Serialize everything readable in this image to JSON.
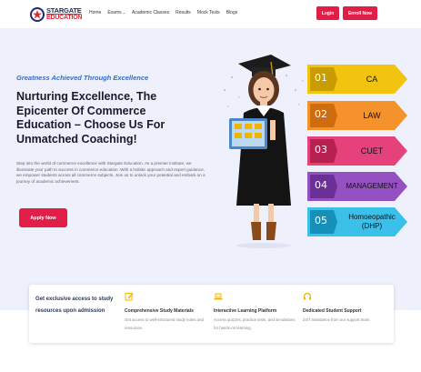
{
  "brand": {
    "line1": "STARGATE",
    "line2": "EDUCATION"
  },
  "nav": {
    "items": [
      "Home",
      "Exams",
      "Academic Classes",
      "Results",
      "Mock Tests",
      "Blogs"
    ],
    "login": "Login",
    "enroll": "Enroll Now"
  },
  "hero": {
    "tagline": "Greatness Achieved Through Excellence",
    "headline": "Nurturing Excellence, The Epicenter Of Commerce Education – Choose Us For Unmatched Coaching!",
    "description": "Step into the world of commerce excellence with Stargate Education. As a premier institute, we illuminate your path to success in commerce education. With a holistic approach and expert guidance, we empower students across all commerce subjects. Join us to unlock your potential and embark on a journey of academic achievement.",
    "apply": "Apply Now"
  },
  "courses": [
    {
      "num": "01",
      "name": "CA",
      "color": "#f2c40f",
      "dark": "#c99d00"
    },
    {
      "num": "02",
      "name": "LAW",
      "color": "#f5922b",
      "dark": "#d06c10"
    },
    {
      "num": "03",
      "name": "CUET",
      "color": "#e5417b",
      "dark": "#b8204f"
    },
    {
      "num": "04",
      "name": "MANAGEMENT",
      "color": "#9551c2",
      "dark": "#6b2f98"
    },
    {
      "num": "05",
      "name": "Homoeopathic (DHP)",
      "color": "#3bc0ea",
      "dark": "#1590b8"
    }
  ],
  "features": {
    "intro": "Get exclusive access to study resources upon admission",
    "items": [
      {
        "icon": "edit-icon",
        "title": "Comprehensive Study Materials",
        "desc": "Get access to well-structured study notes and resources."
      },
      {
        "icon": "laptop-icon",
        "title": "Interactive Learning Platform",
        "desc": "Access quizzes, practice tests, and simulations for hands-on learning."
      },
      {
        "icon": "headset-icon",
        "title": "Dedicated Student Support",
        "desc": "24/7 assistance from our support team."
      }
    ]
  },
  "colors": {
    "accent": "#e11d48",
    "brand_navy": "#1f2a6e",
    "tagline_blue": "#2f6ed3",
    "hero_bg": "#eef0fb",
    "icon_gold": "#f0b400"
  }
}
